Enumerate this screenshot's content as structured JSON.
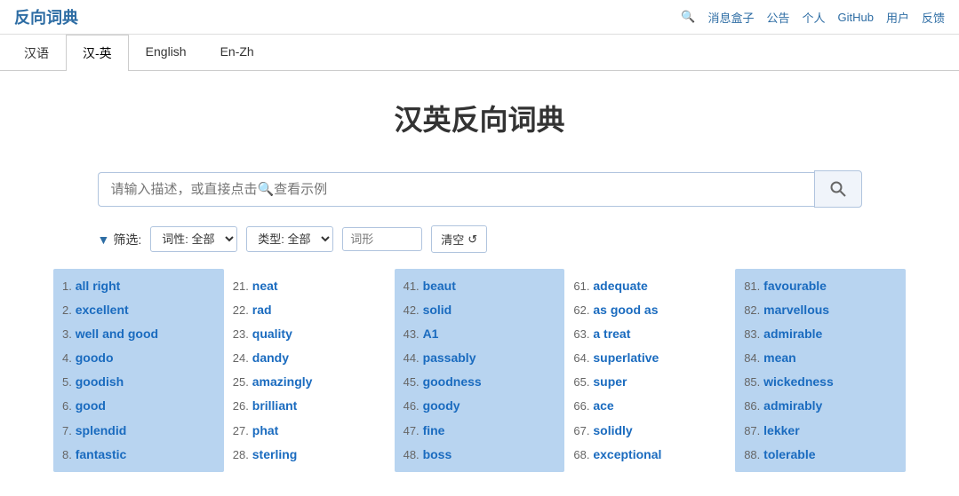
{
  "header": {
    "logo": "反向词典",
    "nav_links": [
      "消息盒子",
      "公告",
      "个人",
      "GitHub",
      "用户",
      "反馈"
    ]
  },
  "tabs": [
    {
      "label": "汉语",
      "active": false
    },
    {
      "label": "汉-英",
      "active": true
    },
    {
      "label": "English",
      "active": false
    },
    {
      "label": "En-Zh",
      "active": false
    }
  ],
  "page_title": "汉英反向词典",
  "search": {
    "placeholder": "请输入描述，或直接点击🔍查看示例",
    "value": ""
  },
  "filters": {
    "label": "筛选:",
    "pos_label": "词性: 全部",
    "type_label": "类型: 全部",
    "morphology_placeholder": "词形",
    "clear_label": "清空"
  },
  "word_columns": [
    {
      "highlight": true,
      "words": [
        {
          "num": "1.",
          "word": "all right"
        },
        {
          "num": "2.",
          "word": "excellent"
        },
        {
          "num": "3.",
          "word": "well and good"
        },
        {
          "num": "4.",
          "word": "goodo"
        },
        {
          "num": "5.",
          "word": "goodish"
        },
        {
          "num": "6.",
          "word": "good"
        },
        {
          "num": "7.",
          "word": "splendid"
        },
        {
          "num": "8.",
          "word": "fantastic"
        }
      ]
    },
    {
      "highlight": false,
      "words": [
        {
          "num": "21.",
          "word": "neat"
        },
        {
          "num": "22.",
          "word": "rad"
        },
        {
          "num": "23.",
          "word": "quality"
        },
        {
          "num": "24.",
          "word": "dandy"
        },
        {
          "num": "25.",
          "word": "amazingly"
        },
        {
          "num": "26.",
          "word": "brilliant"
        },
        {
          "num": "27.",
          "word": "phat"
        },
        {
          "num": "28.",
          "word": "sterling"
        }
      ]
    },
    {
      "highlight": true,
      "words": [
        {
          "num": "41.",
          "word": "beaut"
        },
        {
          "num": "42.",
          "word": "solid"
        },
        {
          "num": "43.",
          "word": "A1"
        },
        {
          "num": "44.",
          "word": "passably"
        },
        {
          "num": "45.",
          "word": "goodness"
        },
        {
          "num": "46.",
          "word": "goody"
        },
        {
          "num": "47.",
          "word": "fine"
        },
        {
          "num": "48.",
          "word": "boss"
        }
      ]
    },
    {
      "highlight": false,
      "words": [
        {
          "num": "61.",
          "word": "adequate"
        },
        {
          "num": "62.",
          "word": "as good as"
        },
        {
          "num": "63.",
          "word": "a treat"
        },
        {
          "num": "64.",
          "word": "superlative"
        },
        {
          "num": "65.",
          "word": "super"
        },
        {
          "num": "66.",
          "word": "ace"
        },
        {
          "num": "67.",
          "word": "solidly"
        },
        {
          "num": "68.",
          "word": "exceptional"
        }
      ]
    },
    {
      "highlight": true,
      "words": [
        {
          "num": "81.",
          "word": "favourable"
        },
        {
          "num": "82.",
          "word": "marvellous"
        },
        {
          "num": "83.",
          "word": "admirable"
        },
        {
          "num": "84.",
          "word": "mean"
        },
        {
          "num": "85.",
          "word": "wickedness"
        },
        {
          "num": "86.",
          "word": "admirably"
        },
        {
          "num": "87.",
          "word": "lekker"
        },
        {
          "num": "88.",
          "word": "tolerable"
        }
      ]
    }
  ]
}
